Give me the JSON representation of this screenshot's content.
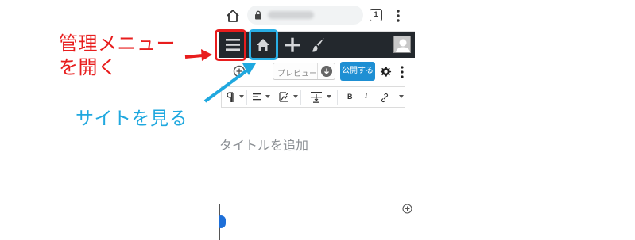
{
  "annotations": {
    "open_admin_menu_line1": "管理メニュー",
    "open_admin_menu_line2": "を開く",
    "view_site": "サイトを見る",
    "colors": {
      "red": "#e81d1d",
      "blue": "#29aee4"
    }
  },
  "browser": {
    "tab_count": "1",
    "url_redacted": "blurred-url",
    "icons": [
      "home-icon",
      "lock-icon",
      "tabs-icon",
      "more-vertical-icon"
    ]
  },
  "admin_bar": {
    "items": [
      "menu-icon",
      "home-icon",
      "plus-icon",
      "brush-icon",
      "avatar"
    ],
    "background": "#23282d"
  },
  "editor_header": {
    "preview_label": "プレビュー",
    "publish_label": "公開する",
    "publish_color": "#1e8fd3"
  },
  "block_toolbar": {
    "items": [
      "paragraph-icon",
      "align-left-icon",
      "image-block-icon",
      "text-wrap-icon"
    ],
    "bold_label": "B",
    "italic_label": "I",
    "link_label": "link"
  },
  "editor": {
    "title_placeholder": "タイトルを追加"
  }
}
